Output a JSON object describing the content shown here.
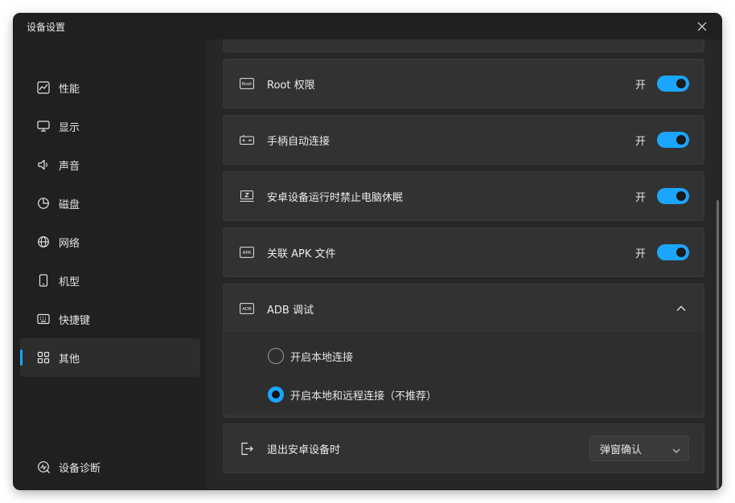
{
  "window": {
    "title": "设备设置"
  },
  "sidebar": {
    "items": [
      {
        "label": "性能",
        "icon": "performance-icon"
      },
      {
        "label": "显示",
        "icon": "monitor-icon"
      },
      {
        "label": "声音",
        "icon": "speaker-icon"
      },
      {
        "label": "磁盘",
        "icon": "pie-chart-icon"
      },
      {
        "label": "网络",
        "icon": "globe-icon"
      },
      {
        "label": "机型",
        "icon": "phone-icon"
      },
      {
        "label": "快捷键",
        "icon": "keyboard-icon"
      },
      {
        "label": "其他",
        "icon": "grid-icon",
        "active": true
      }
    ],
    "footer": {
      "label": "设备诊断",
      "icon": "diagnostics-icon"
    }
  },
  "settings": {
    "root": {
      "label": "Root 权限",
      "state": "开",
      "icon": "root-icon",
      "icon_text": "Root"
    },
    "gamepad": {
      "label": "手柄自动连接",
      "state": "开",
      "icon": "gamepad-icon"
    },
    "no_sleep": {
      "label": "安卓设备运行时禁止电脑休眠",
      "state": "开",
      "icon": "sleep-icon"
    },
    "apk": {
      "label": "关联 APK 文件",
      "state": "开",
      "icon": "apk-icon",
      "icon_text": "APK"
    },
    "adb": {
      "label": "ADB 调试",
      "icon": "adb-icon",
      "icon_text": "ADB",
      "options": [
        {
          "label": "开启本地连接",
          "checked": false
        },
        {
          "label": "开启本地和远程连接（不推荐）",
          "checked": true
        }
      ]
    },
    "exit": {
      "label": "退出安卓设备时",
      "icon": "exit-icon",
      "select_value": "弹窗确认"
    }
  },
  "colors": {
    "accent": "#1aa6ff",
    "card": "#323232",
    "background": "#272727"
  }
}
